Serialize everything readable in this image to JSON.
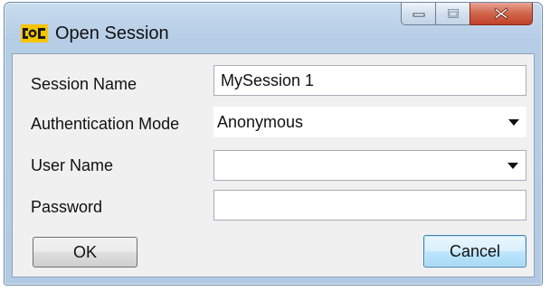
{
  "window": {
    "title": "Open Session",
    "icon": "opc-logo-icon",
    "minimize_icon": "minimize-icon",
    "maximize_icon": "maximize-icon",
    "close_icon": "close-icon"
  },
  "form": {
    "session_name": {
      "label": "Session Name",
      "value": "MySession 1"
    },
    "authentication_mode": {
      "label": "Authentication Mode",
      "value": "Anonymous"
    },
    "user_name": {
      "label": "User Name",
      "value": ""
    },
    "password": {
      "label": "Password",
      "value": ""
    }
  },
  "buttons": {
    "ok_label": "OK",
    "cancel_label": "Cancel"
  },
  "colors": {
    "frame": "#b6cde6",
    "close_button": "#c7523a",
    "focus_button": "#3c7fb1"
  }
}
